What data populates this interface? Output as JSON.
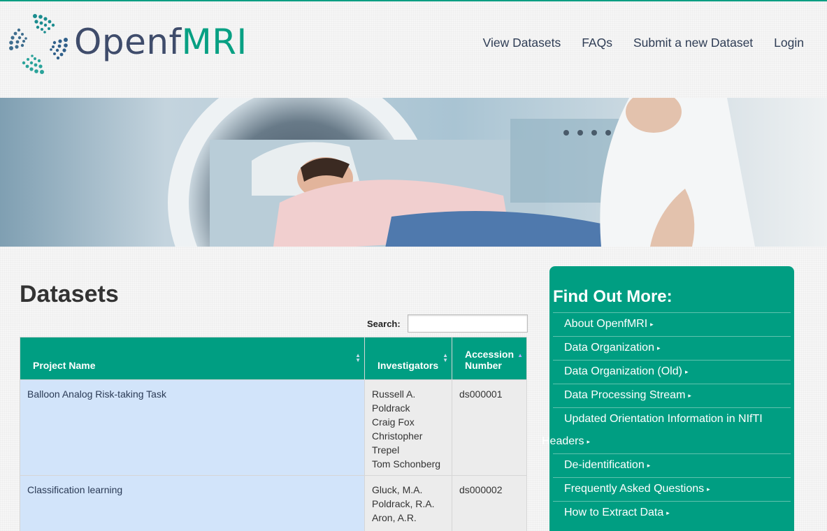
{
  "brand": {
    "word1": "Openf",
    "word2": "MRI"
  },
  "nav": {
    "items": [
      "View Datasets",
      "FAQs",
      "Submit a new Dataset",
      "Login"
    ]
  },
  "datasets": {
    "title": "Datasets",
    "search_label": "Search:",
    "search_value": "",
    "columns": [
      "Project Name",
      "Investigators",
      "Accession Number"
    ],
    "rows": [
      {
        "project": "Balloon Analog Risk-taking Task",
        "investigators": [
          "Russell A.",
          "Poldrack",
          "Craig Fox",
          "Christopher",
          "Trepel",
          "Tom Schonberg"
        ],
        "accession": "ds000001"
      },
      {
        "project": "Classification learning",
        "investigators": [
          "Gluck, M.A.",
          "Poldrack, R.A.",
          "Aron, A.R."
        ],
        "accession": "ds000002"
      }
    ]
  },
  "sidebar": {
    "title": "Find Out More:",
    "items": [
      "About OpenfMRI",
      "Data Organization",
      "Data Organization (Old)",
      "Data Processing Stream",
      "Updated Orientation Information in NIfTI Headers",
      "De-identification",
      "Frequently Asked Questions",
      "How to Extract Data"
    ],
    "arrow": "▸"
  },
  "colors": {
    "accent": "#009e82",
    "brand_dark": "#3f4c6b",
    "link_row": "#d2e4fa"
  }
}
